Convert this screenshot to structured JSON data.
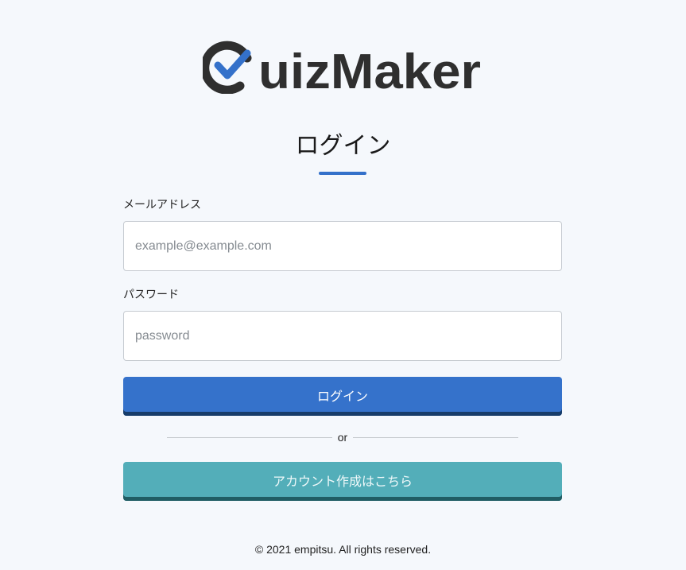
{
  "logo": {
    "text": "uizMaker",
    "brand_color": "#2f2f2f",
    "check_color": "#3471ca",
    "icon": "check-circle-icon"
  },
  "page": {
    "title": "ログイン",
    "accent_color": "#3471ca"
  },
  "form": {
    "email": {
      "label": "メールアドレス",
      "placeholder": "example@example.com",
      "value": ""
    },
    "password": {
      "label": "パスワード",
      "placeholder": "password",
      "value": ""
    },
    "login_button": "ログイン",
    "divider_text": "or",
    "signup_button": "アカウント作成はこちら"
  },
  "colors": {
    "background": "#f5f8fc",
    "login_button": "#3572cb",
    "signup_button": "#53aeb9"
  },
  "footer": {
    "copyright": "© 2021 empitsu. All rights reserved."
  }
}
